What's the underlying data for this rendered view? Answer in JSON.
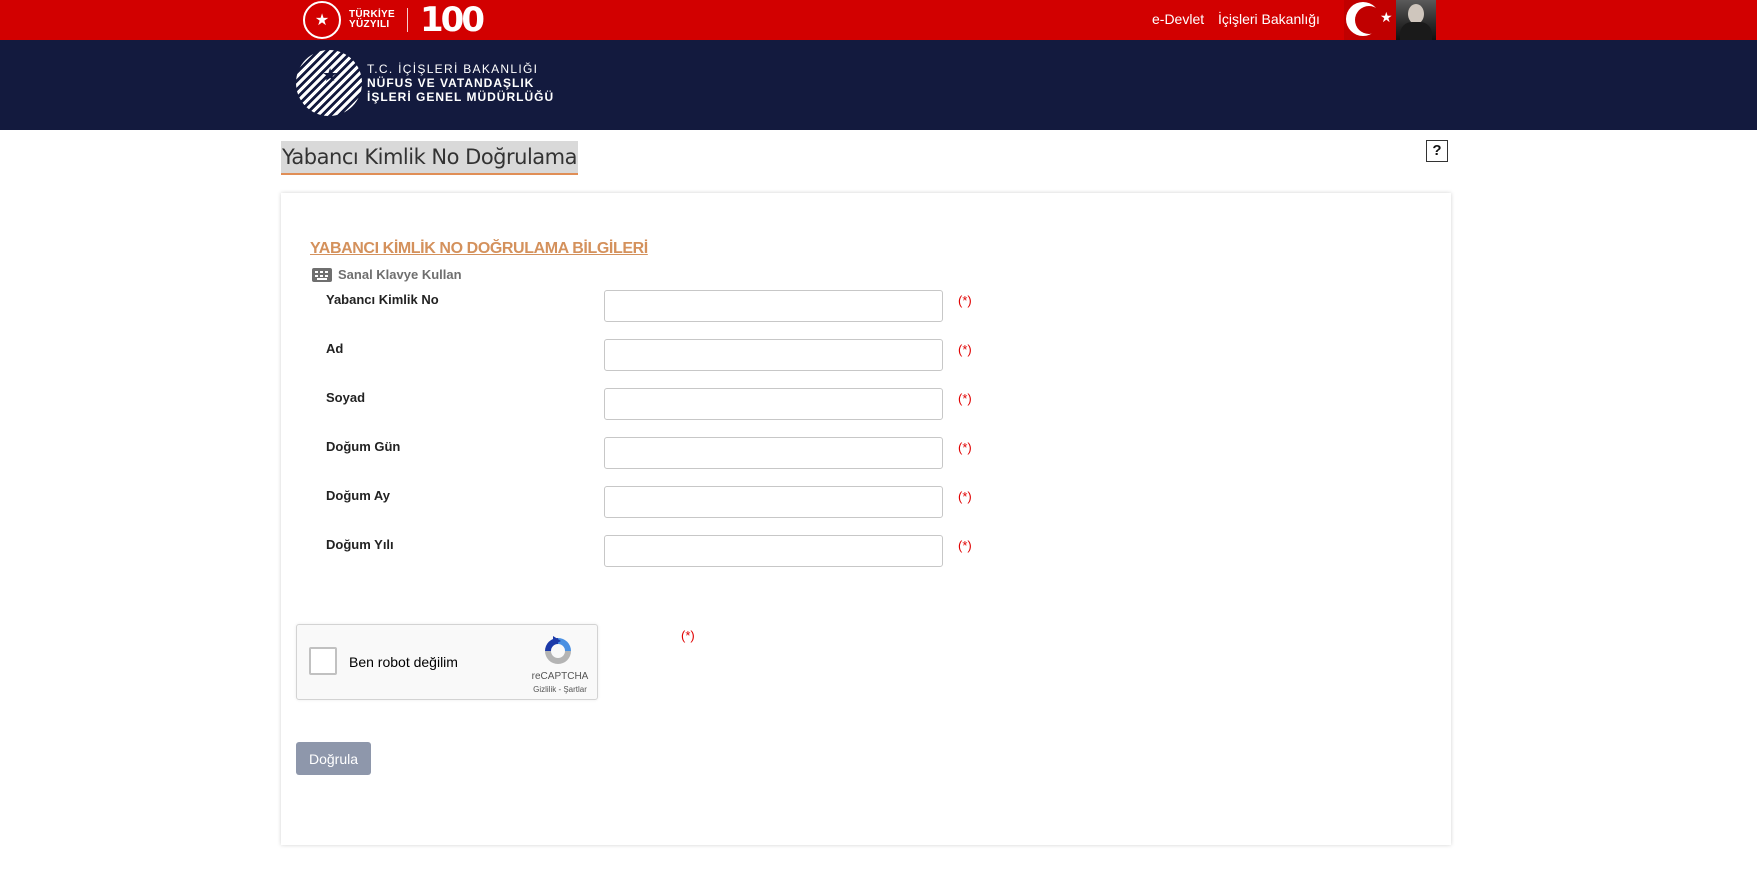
{
  "topbar": {
    "logo_line1": "TÜRKİYE",
    "logo_line2": "YÜZYILI",
    "logo_100": "100",
    "link_edevlet": "e-Devlet",
    "link_ministry": "İçişleri Bakanlığı",
    "color": "#d20000"
  },
  "header": {
    "line1": "T.C. İÇİŞLERİ BAKANLIĞI",
    "line2": "NÜFUS VE VATANDAŞLIK",
    "line3": "İŞLERİ GENEL MÜDÜRLÜĞÜ",
    "color": "#131a3e"
  },
  "page": {
    "title": "Yabancı Kimlik No Doğrulama",
    "help_label": "?"
  },
  "form": {
    "section_title": "YABANCI KİMLİK NO DOĞRULAMA BİLGİLERİ",
    "virtual_keyboard": "Sanal Klavye Kullan",
    "required_mark": "(*)",
    "fields": [
      {
        "label": "Yabancı Kimlik No",
        "value": ""
      },
      {
        "label": "Ad",
        "value": ""
      },
      {
        "label": "Soyad",
        "value": ""
      },
      {
        "label": "Doğum Gün",
        "value": ""
      },
      {
        "label": "Doğum Ay",
        "value": ""
      },
      {
        "label": "Doğum Yılı",
        "value": ""
      }
    ],
    "captcha": {
      "label": "Ben robot değilim",
      "brand": "reCAPTCHA",
      "links": "Gizlilik - Şartlar"
    },
    "submit_label": "Doğrula",
    "accent_color": "#d4915c",
    "required_color": "#e00000"
  }
}
